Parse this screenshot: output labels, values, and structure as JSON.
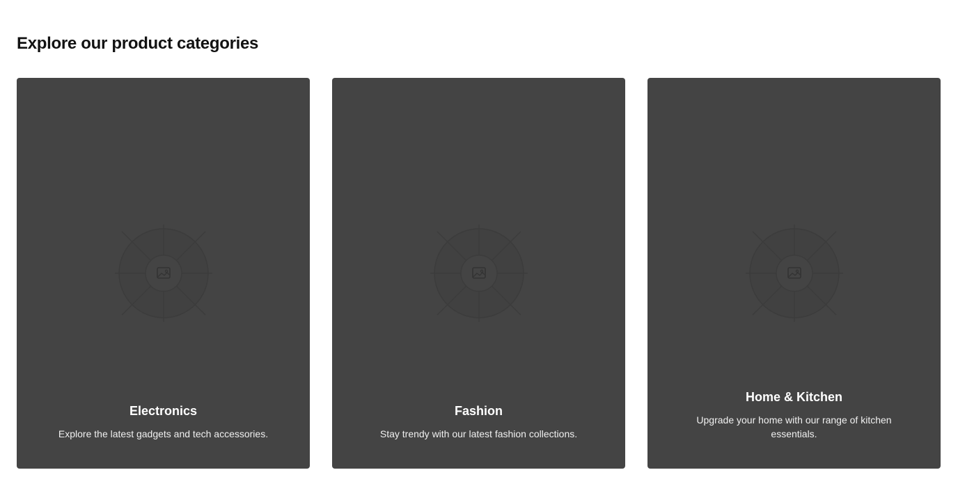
{
  "section": {
    "title": "Explore our product categories"
  },
  "cards": [
    {
      "title": "Electronics",
      "description": "Explore the latest gadgets and tech accessories.",
      "icon": "image-placeholder-icon"
    },
    {
      "title": "Fashion",
      "description": "Stay trendy with our latest fashion collections.",
      "icon": "image-placeholder-icon"
    },
    {
      "title": "Home & Kitchen",
      "description": "Upgrade your home with our range of kitchen essentials.",
      "icon": "image-placeholder-icon"
    }
  ],
  "colors": {
    "card_background": "#444444",
    "placeholder_stroke": "#3a3a3a",
    "title_text": "#121212",
    "card_text": "#ffffff"
  }
}
